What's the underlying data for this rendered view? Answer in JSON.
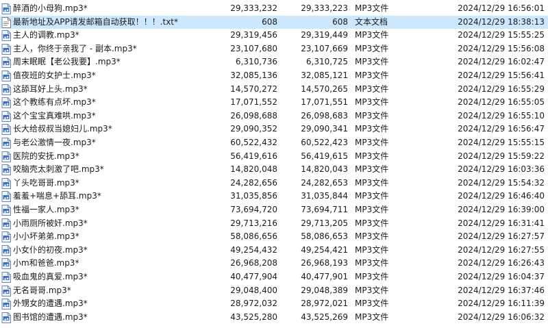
{
  "files": [
    {
      "name": "醉酒的小母狗.mp3*",
      "size": "29,333,232",
      "packed": "29,333,223",
      "type": "MP3文件",
      "modified": "2024/12/29 16:56:01",
      "icon": "mp3-file-icon",
      "selected": false
    },
    {
      "name": "最新地址及APP请发邮箱自动获取！！！.txt*",
      "size": "608",
      "packed": "608",
      "type": "文本文档",
      "modified": "2024/12/29 18:38:13",
      "icon": "text-file-icon",
      "selected": true
    },
    {
      "name": "主人的调教.mp3*",
      "size": "29,319,456",
      "packed": "29,319,449",
      "type": "MP3文件",
      "modified": "2024/12/29 15:55:25",
      "icon": "mp3-file-icon",
      "selected": false
    },
    {
      "name": "主人，你终于亲我了 - 副本.mp3*",
      "size": "23,107,680",
      "packed": "23,107,669",
      "type": "MP3文件",
      "modified": "2024/12/29 15:56:08",
      "icon": "mp3-file-icon",
      "selected": false
    },
    {
      "name": "周末眠眠【老公我要】.mp3*",
      "size": "6,310,736",
      "packed": "6,310,725",
      "type": "MP3文件",
      "modified": "2024/12/29 16:02:47",
      "icon": "mp3-file-icon",
      "selected": false
    },
    {
      "name": "值夜班的女护士.mp3*",
      "size": "32,085,136",
      "packed": "32,085,121",
      "type": "MP3文件",
      "modified": "2024/12/29 15:56:41",
      "icon": "mp3-file-icon",
      "selected": false
    },
    {
      "name": "这舔耳好上头.mp3*",
      "size": "14,570,272",
      "packed": "14,570,265",
      "type": "MP3文件",
      "modified": "2024/12/29 16:55:29",
      "icon": "mp3-file-icon",
      "selected": false
    },
    {
      "name": "这个教练有点坏.mp3*",
      "size": "17,071,552",
      "packed": "17,071,551",
      "type": "MP3文件",
      "modified": "2024/12/29 16:55:05",
      "icon": "mp3-file-icon",
      "selected": false
    },
    {
      "name": "这个宝宝真难哄.mp3*",
      "size": "26,098,688",
      "packed": "26,098,683",
      "type": "MP3文件",
      "modified": "2024/12/29 16:55:10",
      "icon": "mp3-file-icon",
      "selected": false
    },
    {
      "name": "长大给叔叔当媳妇儿.mp3*",
      "size": "29,090,352",
      "packed": "29,090,341",
      "type": "MP3文件",
      "modified": "2024/12/29 16:56:47",
      "icon": "mp3-file-icon",
      "selected": false
    },
    {
      "name": "与老公激情一夜.mp3*",
      "size": "60,522,432",
      "packed": "60,522,423",
      "type": "MP3文件",
      "modified": "2024/12/29 15:55:15",
      "icon": "mp3-file-icon",
      "selected": false
    },
    {
      "name": "医院的安抚.mp3*",
      "size": "56,419,616",
      "packed": "56,419,615",
      "type": "MP3文件",
      "modified": "2024/12/29 15:59:22",
      "icon": "mp3-file-icon",
      "selected": false
    },
    {
      "name": "咬脑壳太刺激了吧.mp3*",
      "size": "14,820,048",
      "packed": "14,820,043",
      "type": "MP3文件",
      "modified": "2024/12/29 16:03:36",
      "icon": "mp3-file-icon",
      "selected": false
    },
    {
      "name": "丫头吃哥哥.mp3*",
      "size": "24,282,656",
      "packed": "24,282,653",
      "type": "MP3文件",
      "modified": "2024/12/29 15:54:32",
      "icon": "mp3-file-icon",
      "selected": false
    },
    {
      "name": "羞羞+喘息+舔耳.mp3*",
      "size": "31,035,856",
      "packed": "31,035,844",
      "type": "MP3文件",
      "modified": "2024/12/29 16:46:40",
      "icon": "mp3-file-icon",
      "selected": false
    },
    {
      "name": "性福一家人.mp3*",
      "size": "73,694,720",
      "packed": "73,694,711",
      "type": "MP3文件",
      "modified": "2024/12/29 16:39:00",
      "icon": "mp3-file-icon",
      "selected": false
    },
    {
      "name": "小雨厕所被奸.mp3*",
      "size": "29,713,216",
      "packed": "29,713,205",
      "type": "MP3文件",
      "modified": "2024/12/29 16:31:41",
      "icon": "mp3-file-icon",
      "selected": false
    },
    {
      "name": "小小坏弟弟.mp3*",
      "size": "58,086,656",
      "packed": "58,086,653",
      "type": "MP3文件",
      "modified": "2024/12/29 16:27:57",
      "icon": "mp3-file-icon",
      "selected": false
    },
    {
      "name": "小女仆的初夜.mp3*",
      "size": "49,254,432",
      "packed": "49,254,421",
      "type": "MP3文件",
      "modified": "2024/12/29 16:27:55",
      "icon": "mp3-file-icon",
      "selected": false
    },
    {
      "name": "小m和爸爸.mp3*",
      "size": "26,968,208",
      "packed": "26,968,193",
      "type": "MP3文件",
      "modified": "2024/12/29 16:26:43",
      "icon": "mp3-file-icon",
      "selected": false
    },
    {
      "name": "吸血鬼的真爱.mp3*",
      "size": "40,477,904",
      "packed": "40,477,901",
      "type": "MP3文件",
      "modified": "2024/12/29 16:04:37",
      "icon": "mp3-file-icon",
      "selected": false
    },
    {
      "name": "无名哥哥.mp3*",
      "size": "29,048,400",
      "packed": "29,048,389",
      "type": "MP3文件",
      "modified": "2024/12/29 16:37:46",
      "icon": "mp3-file-icon",
      "selected": false
    },
    {
      "name": "外甥女的遭遇.mp3*",
      "size": "28,972,032",
      "packed": "28,972,021",
      "type": "MP3文件",
      "modified": "2024/12/29 16:11:39",
      "icon": "mp3-file-icon",
      "selected": false
    },
    {
      "name": "图书馆的遭遇.mp3*",
      "size": "43,525,280",
      "packed": "43,525,269",
      "type": "MP3文件",
      "modified": "2024/12/29 16:06:32",
      "icon": "mp3-file-icon",
      "selected": false
    }
  ]
}
